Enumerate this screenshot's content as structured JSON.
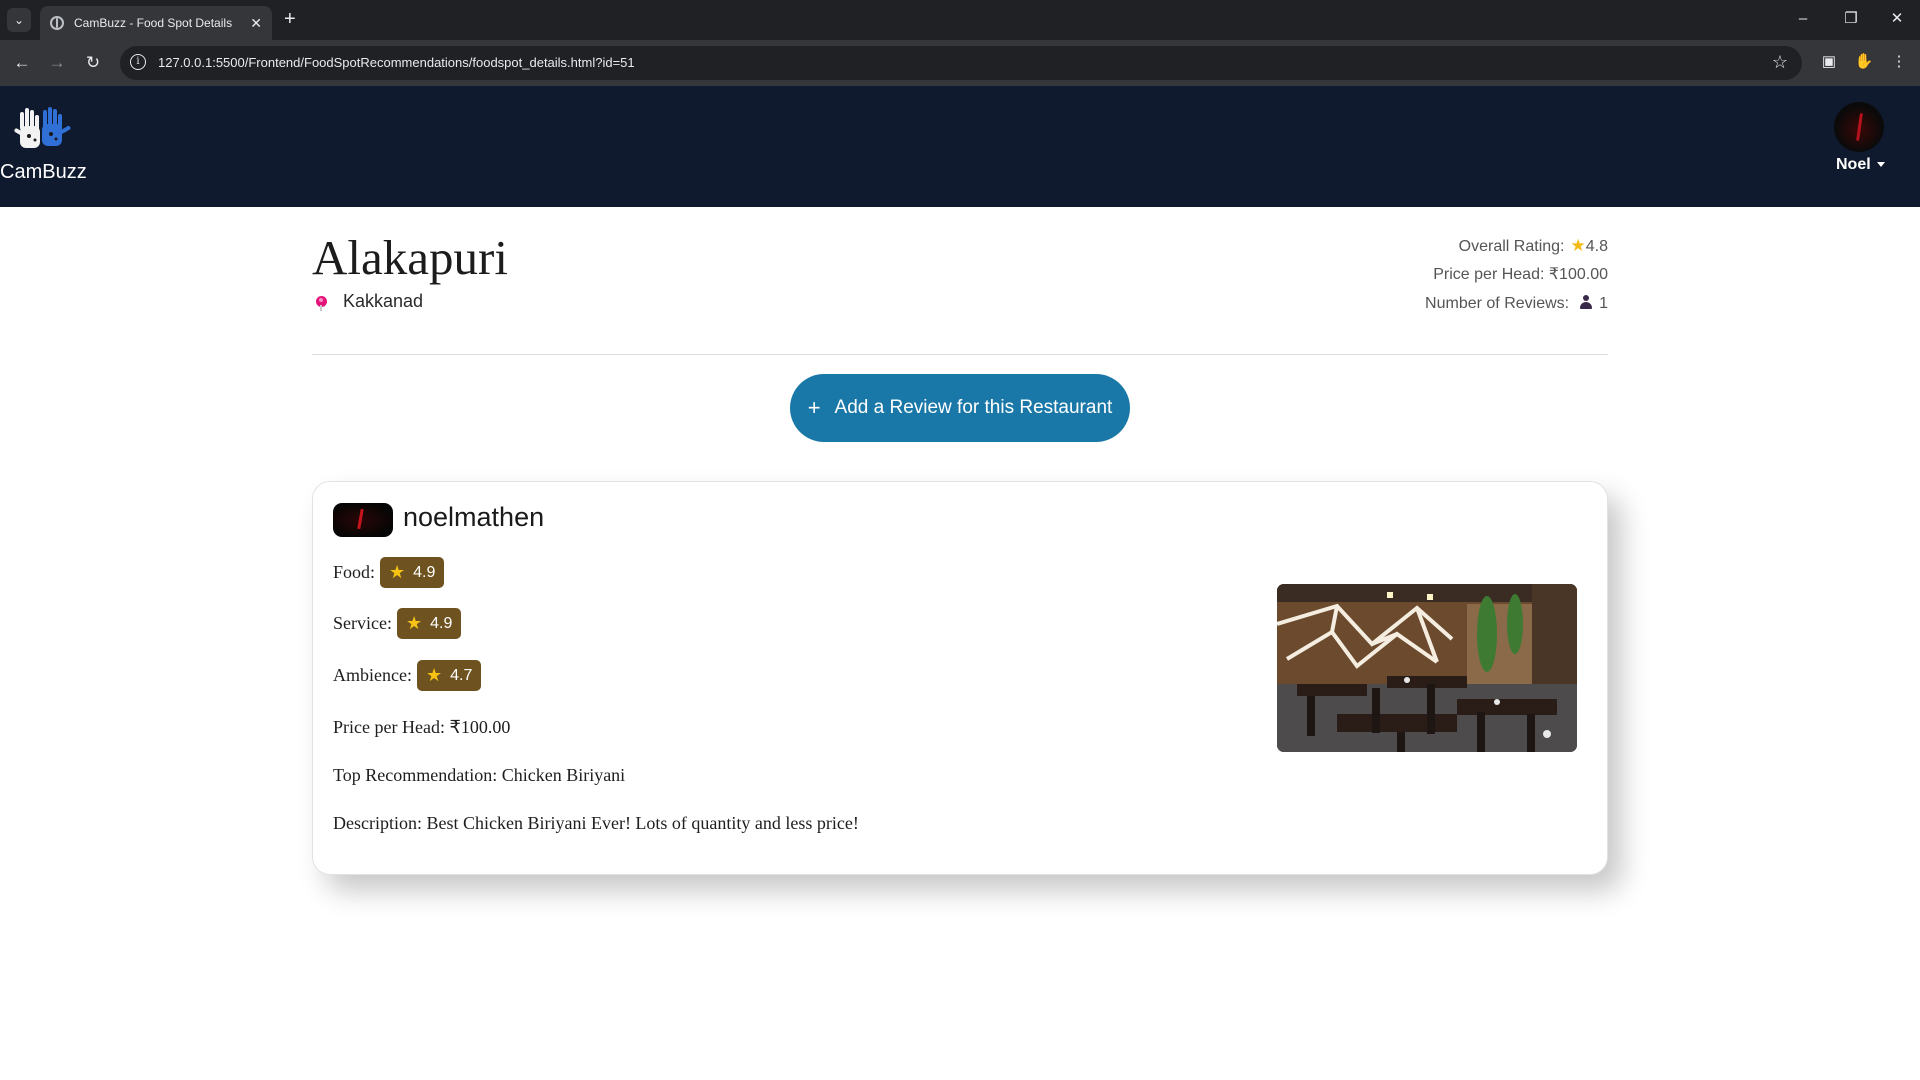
{
  "browser": {
    "tab_title": "CamBuzz - Food Spot Details",
    "url": "127.0.0.1:5500/Frontend/FoodSpotRecommendations/foodspot_details.html?id=51"
  },
  "navbar": {
    "brand": "CamBuzz",
    "user_name": "Noel"
  },
  "restaurant": {
    "name": "Alakapuri",
    "location": "Kakkanad",
    "overall_rating_label": "Overall Rating:",
    "overall_rating": "4.8",
    "price_label": "Price per Head:",
    "price": "₹100.00",
    "reviews_label": "Number of Reviews:",
    "reviews_count": "1"
  },
  "add_review_button": "Add a Review for this Restaurant",
  "review": {
    "username": "noelmathen",
    "food_label": "Food:",
    "food_rating": "4.9",
    "service_label": "Service:",
    "service_rating": "4.9",
    "ambience_label": "Ambience:",
    "ambience_rating": "4.7",
    "price_text": "Price per Head: ₹100.00",
    "top_recommendation_text": "Top Recommendation: Chicken Biriyani",
    "description_text": "Description: Best Chicken Biriyani Ever! Lots of quantity and less price!"
  },
  "icons": {
    "tab_list": "chevron-down-icon",
    "favicon": "globe-icon",
    "close": "close-icon",
    "new_tab": "plus-icon",
    "back": "arrow-left-icon",
    "forward": "arrow-right-icon",
    "reload": "reload-icon",
    "bookmark": "star-outline-icon",
    "location": "pin-icon",
    "rating": "star-icon",
    "reviews": "person-icon"
  },
  "colors": {
    "navbar_bg": "#0f1a2e",
    "button_bg": "#1a78a8",
    "badge_bg": "#6e5320",
    "star": "#f5b914",
    "pin": "#e3137a"
  }
}
